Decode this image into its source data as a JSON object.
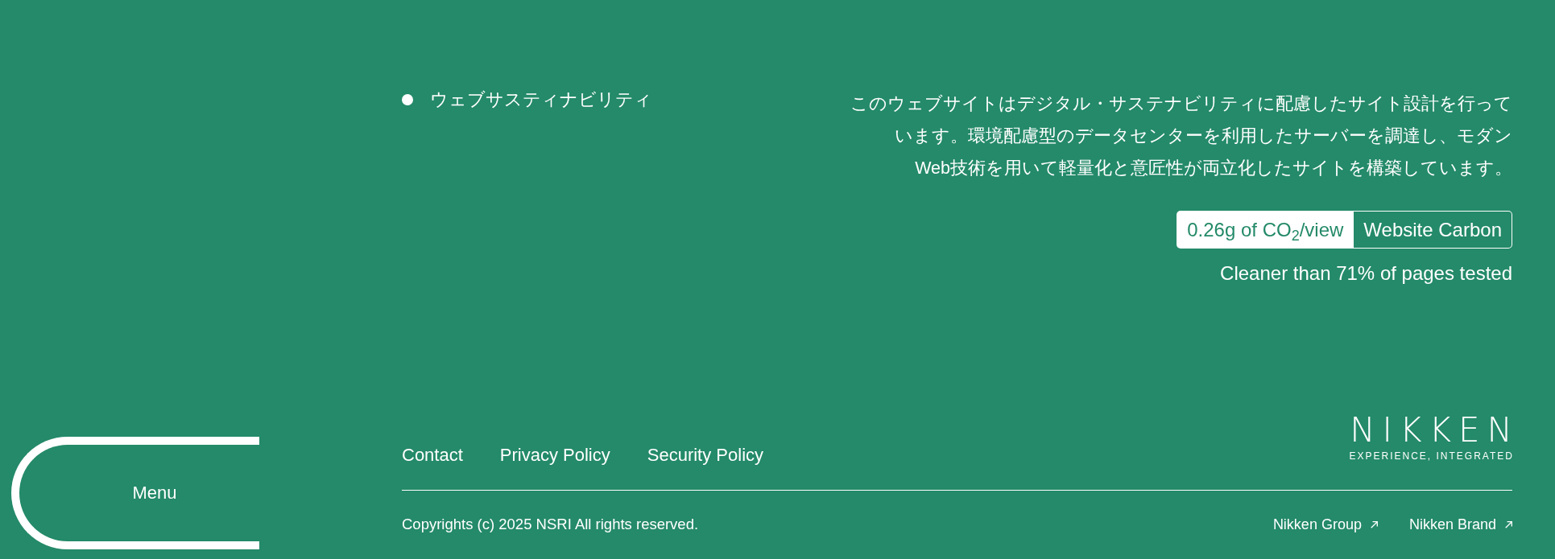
{
  "menu_button": {
    "label": "Menu"
  },
  "nav_links": [
    {
      "label": "ウェブサスティナビリティ"
    }
  ],
  "sustainability": {
    "description_lines": [
      "このウェブサイトはデジタル・サステナビリティに配慮したサイト設計を行って",
      "います。環境配慮型のデータセンターを利用したサーバーを調達し、モダン",
      "Web技術を用いて軽量化と意匠性が両立化したサイトを構築しています。"
    ],
    "carbon_badge": {
      "reading": "0.26g of CO$_{2}$/view",
      "link": "Website Carbon"
    },
    "comparison": "Cleaner than 71% of pages tested"
  },
  "footer": {
    "links": [
      "Contact",
      "Privacy Policy",
      "Security Policy"
    ],
    "logo": {
      "wordmark": "NIKKEN",
      "tagline": "EXPERIENCE, INTEGRATED"
    },
    "copyright": "Copyrights (c) 2025 NSRI All rights reserved.",
    "external_links": [
      {
        "label": "Nikken Group"
      },
      {
        "label": "Nikken Brand"
      }
    ]
  }
}
